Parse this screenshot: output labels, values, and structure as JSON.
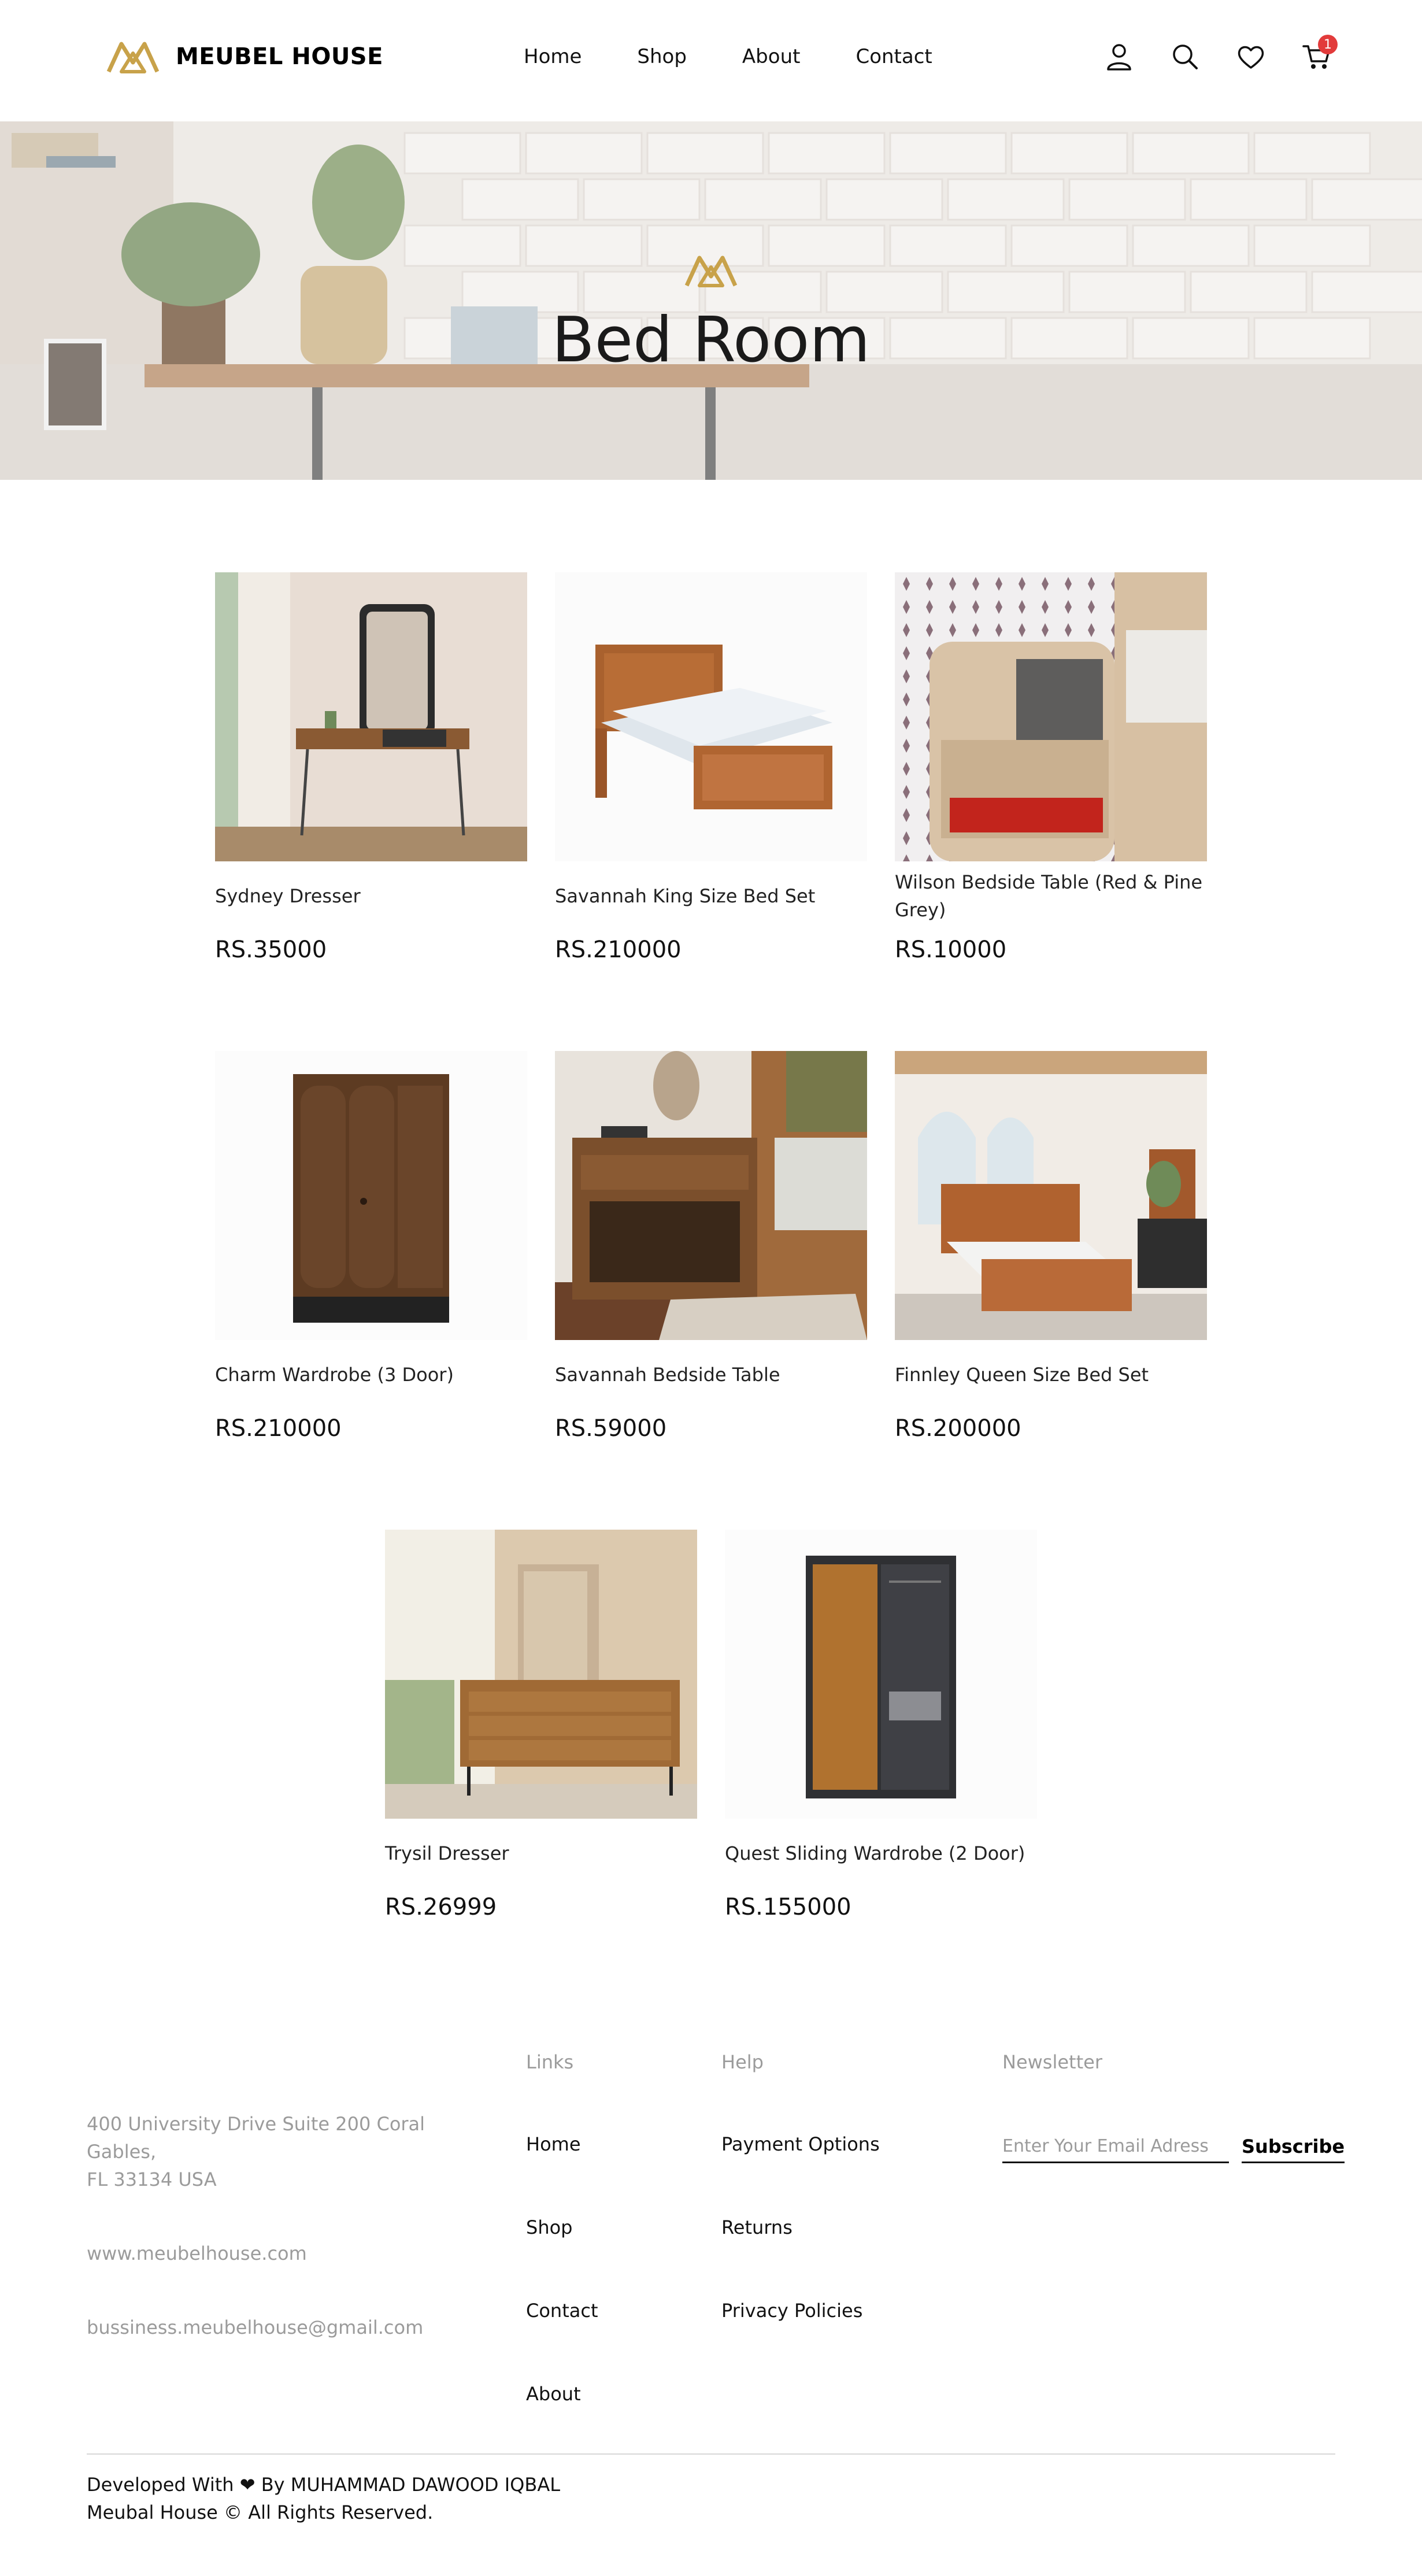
{
  "brand": {
    "name": "MEUBEL HOUSE",
    "accent": "#c8a24a"
  },
  "nav": {
    "items": [
      "Home",
      "Shop",
      "About",
      "Contact"
    ]
  },
  "header_icons": {
    "account": "user-icon",
    "search": "search-icon",
    "wishlist": "heart-icon",
    "cart": "cart-icon",
    "cart_count": "1"
  },
  "hero": {
    "title": "Bed Room"
  },
  "products": [
    {
      "name": "Sydney Dresser",
      "price": "RS.35000"
    },
    {
      "name": "Savannah King Size Bed Set",
      "price": "RS.210000"
    },
    {
      "name": "Wilson Bedside Table (Red & Pine Grey)",
      "price": "RS.10000"
    },
    {
      "name": "Charm Wardrobe (3 Door)",
      "price": "RS.210000"
    },
    {
      "name": "Savannah Bedside Table",
      "price": "RS.59000"
    },
    {
      "name": "Finnley Queen Size Bed Set",
      "price": "RS.200000"
    },
    {
      "name": "Trysil Dresser",
      "price": "RS.26999"
    },
    {
      "name": "Quest Sliding Wardrobe (2 Door)",
      "price": "RS.155000"
    }
  ],
  "footer": {
    "address_line1": "400 University Drive Suite 200 Coral",
    "address_line2": "Gables,",
    "address_line3": "FL 33134 USA",
    "website": "www.meubelhouse.com",
    "email": "bussiness.meubelhouse@gmail.com",
    "links_heading": "Links",
    "links": [
      "Home",
      "Shop",
      "Contact",
      "About"
    ],
    "help_heading": "Help",
    "help": [
      "Payment Options",
      "Returns",
      "Privacy Policies"
    ],
    "newsletter_heading": "Newsletter",
    "newsletter_placeholder": "Enter Your Email Adress",
    "subscribe_label": "Subscribe",
    "credit_before": "Developed With",
    "credit_after": "By MUHAMMAD DAWOOD IQBAL",
    "copyright": "Meubal House © All Rights Reserved."
  }
}
